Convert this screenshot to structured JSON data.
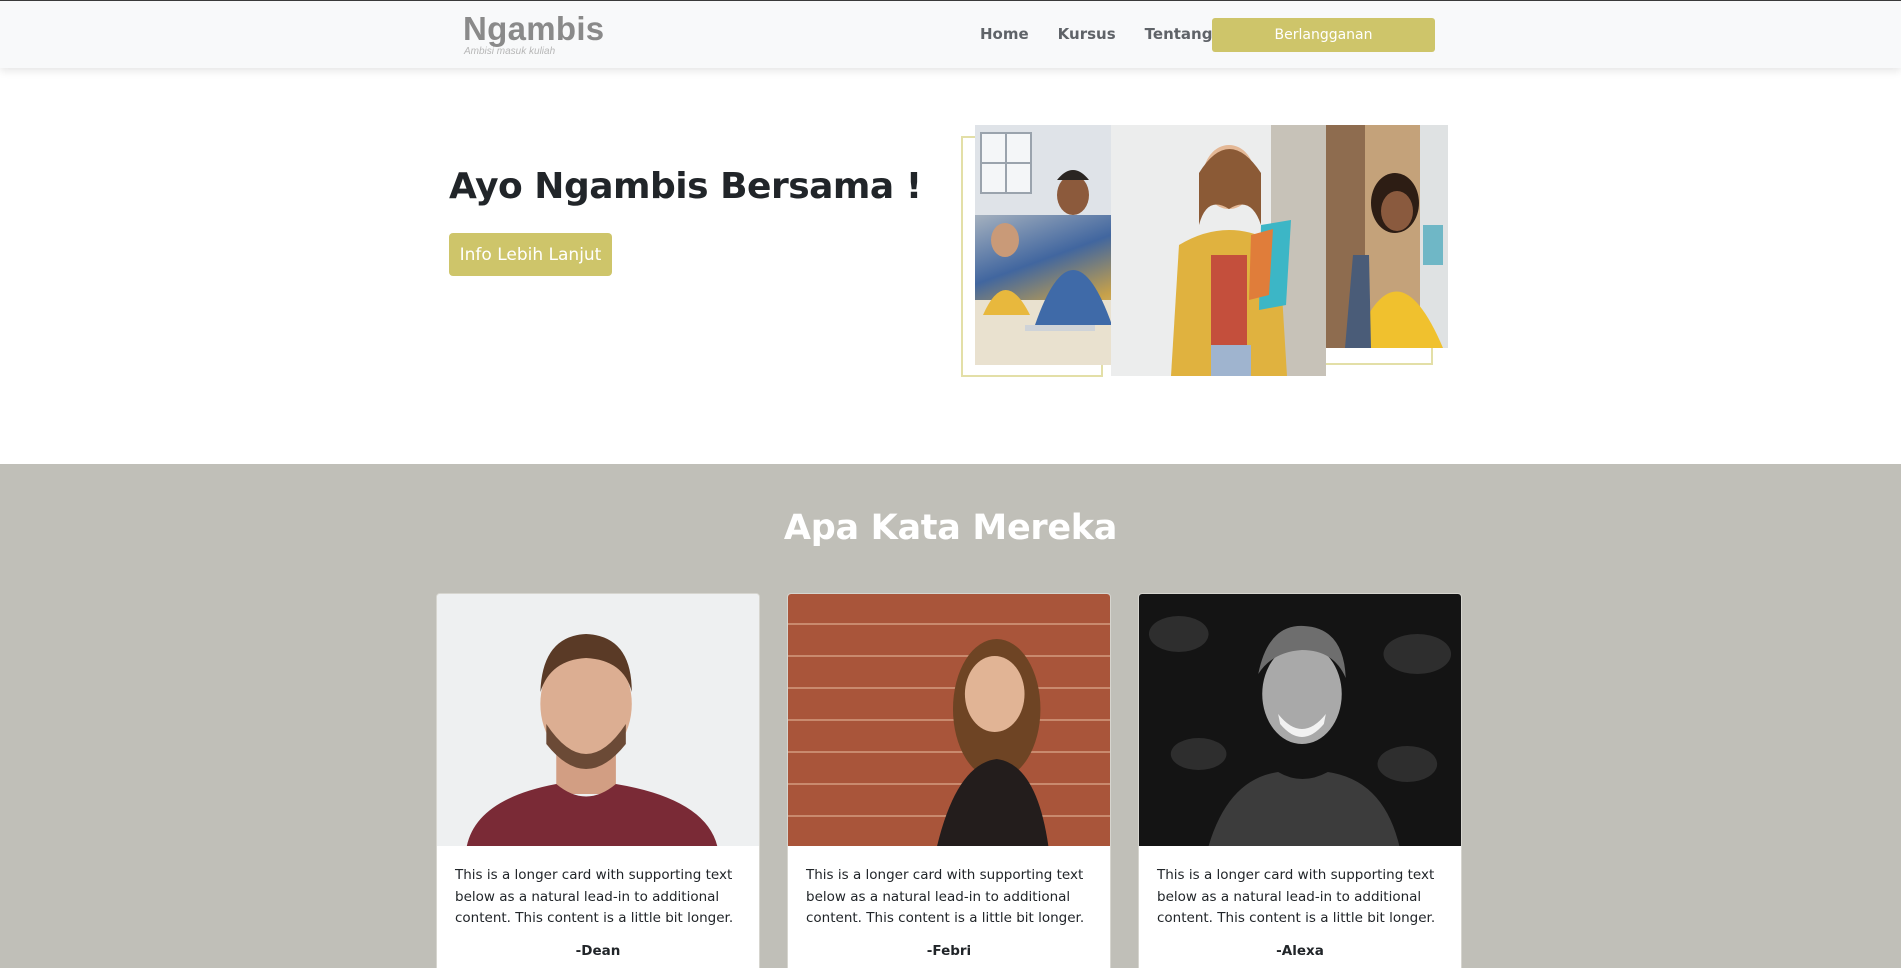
{
  "brand": {
    "name": "Ngambis",
    "tagline": "Ambisi masuk kuliah"
  },
  "nav": {
    "links": [
      "Home",
      "Kursus",
      "Tentang"
    ],
    "subscribe_label": "Berlangganan"
  },
  "hero": {
    "title": "Ayo Ngambis Bersama !",
    "button_label": "Info Lebih Lanjut"
  },
  "testimonials": {
    "title": "Apa Kata Mereka",
    "cards": [
      {
        "text": "This is a longer card with supporting text below as a natural lead-in to additional content. This content is a little bit longer.",
        "author": "-Dean"
      },
      {
        "text": "This is a longer card with supporting text below as a natural lead-in to additional content. This content is a little bit longer.",
        "author": "-Febri"
      },
      {
        "text": "This is a longer card with supporting text below as a natural lead-in to additional content. This content is a little bit longer.",
        "author": "-Alexa"
      }
    ]
  },
  "colors": {
    "accent": "#cec56a",
    "testimonial_bg": "#c0bfb8",
    "navbar_bg": "#f8f9fa"
  }
}
